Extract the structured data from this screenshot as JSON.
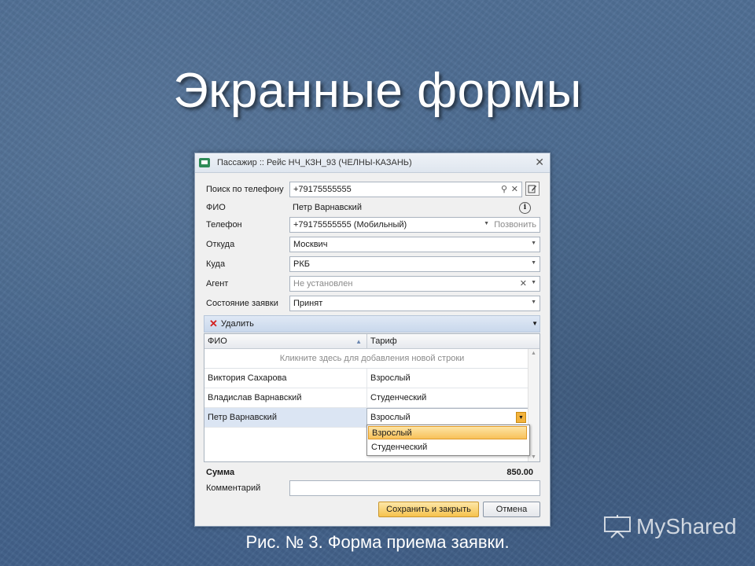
{
  "slide": {
    "title": "Экранные формы",
    "caption": "Рис. № 3. Форма приема заявки.",
    "watermark": "MyShared"
  },
  "window": {
    "title": "Пассажир :: Рейс НЧ_КЗН_93 (ЧЕЛНЫ-КАЗАНЬ)",
    "close_glyph": "✕"
  },
  "form": {
    "search": {
      "label": "Поиск по телефону",
      "value": "+79175555555"
    },
    "fio": {
      "label": "ФИО",
      "value": "Петр Варнавский"
    },
    "phone": {
      "label": "Телефон",
      "value": "+79175555555 (Мобильный)",
      "call_label": "Позвонить"
    },
    "from": {
      "label": "Откуда",
      "value": "Москвич"
    },
    "to": {
      "label": "Куда",
      "value": "РКБ"
    },
    "agent": {
      "label": "Агент",
      "placeholder": "Не установлен"
    },
    "status": {
      "label": "Состояние заявки",
      "value": "Принят"
    }
  },
  "toolbar": {
    "delete_label": "Удалить"
  },
  "grid": {
    "columns": [
      "ФИО",
      "Тариф"
    ],
    "new_row_hint": "Кликните здесь для добавления новой строки",
    "rows": [
      {
        "fio": "Виктория Сахарова",
        "tariff": "Взрослый"
      },
      {
        "fio": "Владислав Варнавский",
        "tariff": "Студенческий"
      },
      {
        "fio": "Петр Варнавский",
        "tariff": "Взрослый"
      }
    ],
    "dropdown_options": [
      "Взрослый",
      "Студенческий"
    ]
  },
  "summary": {
    "label": "Сумма",
    "value": "850.00"
  },
  "comment": {
    "label": "Комментарий",
    "value": ""
  },
  "buttons": {
    "save_close": "Сохранить и закрыть",
    "cancel": "Отмена"
  },
  "colors": {
    "accent": "#f6c24e",
    "delete": "#d32020",
    "selection": "#dbe5f3"
  }
}
